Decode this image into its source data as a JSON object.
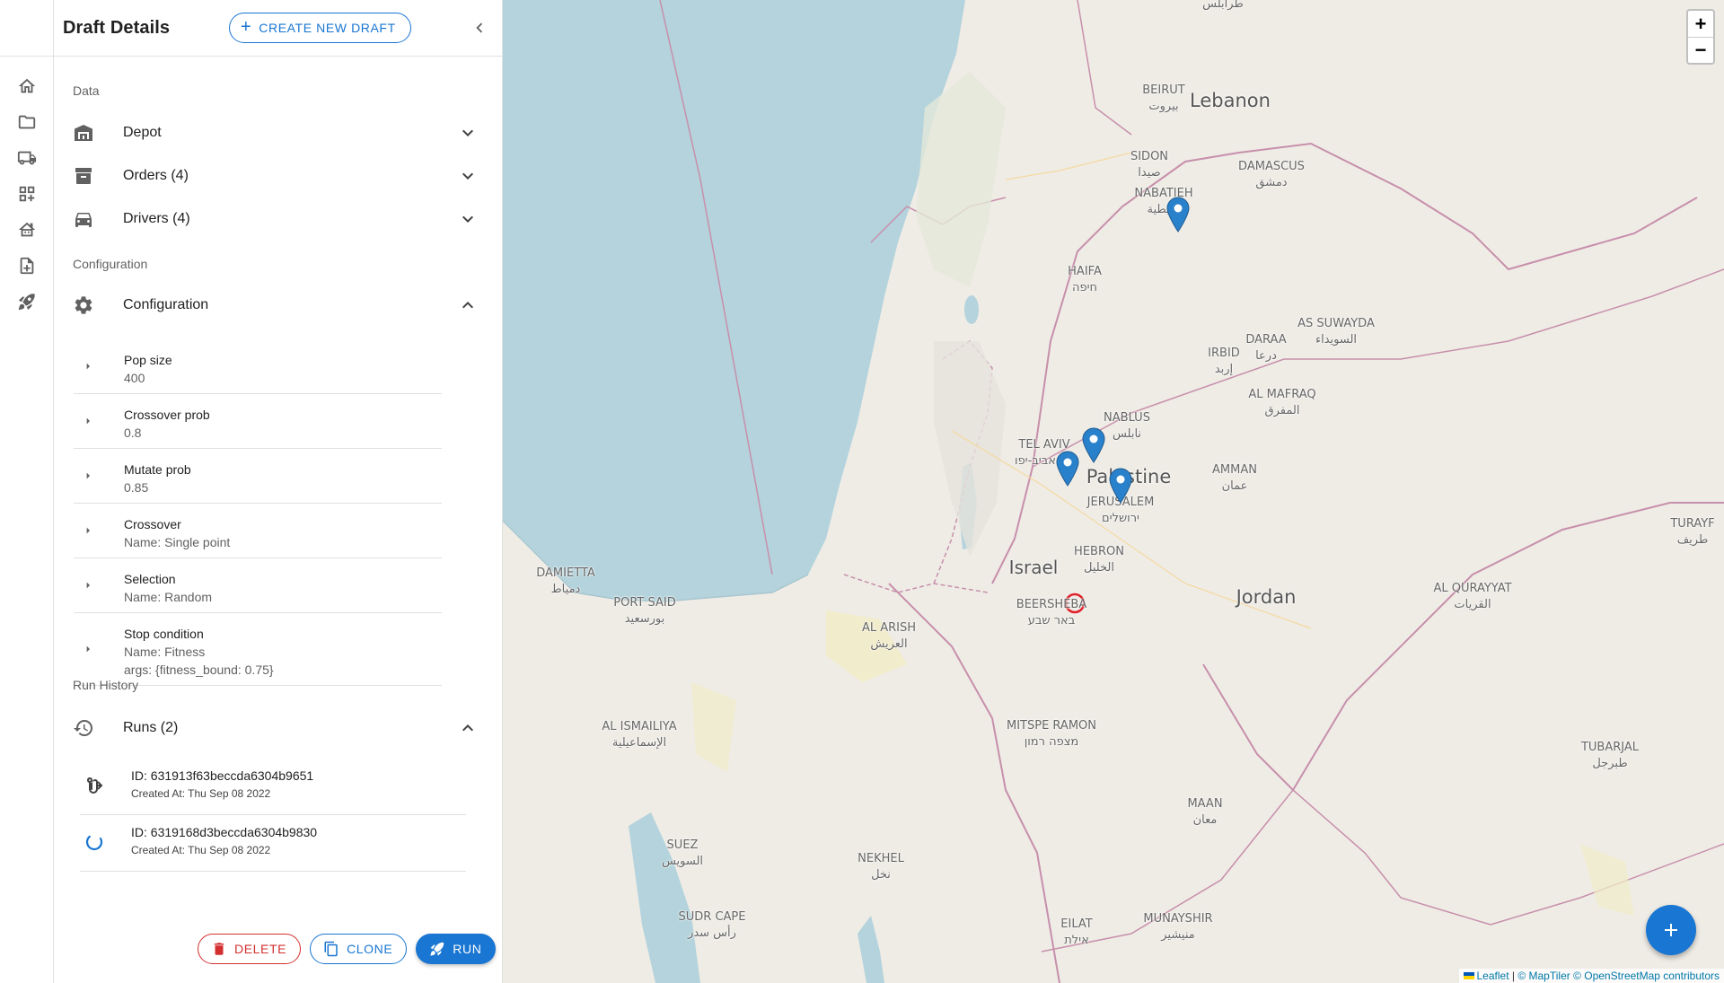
{
  "rail": {
    "items": [
      {
        "icon": "home-icon"
      },
      {
        "icon": "folder-icon"
      },
      {
        "icon": "truck-icon"
      },
      {
        "icon": "dashboard-icon"
      },
      {
        "icon": "garage-icon"
      },
      {
        "icon": "note-add-icon"
      },
      {
        "icon": "rocket-icon"
      }
    ]
  },
  "drawer": {
    "title": "Draft Details",
    "create_button": "CREATE NEW DRAFT",
    "sections": {
      "data": "Data",
      "configuration": "Configuration",
      "run_history": "Run History"
    },
    "accordions": {
      "depot": "Depot",
      "orders": "Orders (4)",
      "drivers": "Drivers (4)",
      "configuration": "Configuration",
      "runs": "Runs (2)"
    },
    "config_items": [
      {
        "name": "Pop size",
        "lines": [
          "400"
        ]
      },
      {
        "name": "Crossover prob",
        "lines": [
          "0.8"
        ]
      },
      {
        "name": "Mutate prob",
        "lines": [
          "0.85"
        ]
      },
      {
        "name": "Crossover",
        "lines": [
          "Name: Single point"
        ]
      },
      {
        "name": "Selection",
        "lines": [
          "Name: Random"
        ]
      },
      {
        "name": "Stop condition",
        "lines": [
          "Name: Fitness",
          "args: {fitness_bound: 0.75}"
        ]
      }
    ],
    "runs": [
      {
        "id": "ID: 631913f63beccda6304b9651",
        "created": "Created At: Thu Sep 08 2022",
        "status_icon": "route-icon"
      },
      {
        "id": "ID: 6319168d3beccda6304b9830",
        "created": "Created At: Thu Sep 08 2022",
        "status_icon": "spinner-icon"
      }
    ],
    "actions": {
      "delete": "DELETE",
      "clone": "CLONE",
      "run": "RUN"
    }
  },
  "map": {
    "zoom_in": "+",
    "zoom_out": "−",
    "attribution": {
      "leaflet": "Leaflet",
      "sep": " | ",
      "maptiler": "© MapTiler",
      "osm": "© OpenStreetMap contributors"
    },
    "labels": {
      "tarabulus": "طرابلس",
      "beirut": "BEIRUT\nبيروت",
      "lebanon": "Lebanon",
      "sidon": "SIDON\nصيدا",
      "nabatieh": "NABATIEH\nالنبطية",
      "damascus": "DAMASCUS\nدمشق",
      "haifa": "HAIFA\nחיפה",
      "daraa": "DARAA\nدرعا",
      "as_suwayda": "AS SUWAYDA\nالسويداء",
      "irbid": "IRBID\nإربد",
      "al_mafraq": "AL MAFRAQ\nالمفرق",
      "nablus": "NABLUS\nنابلس",
      "tel_aviv": "TEL AVIV\nתל אביב-יפו",
      "palestine": "Palestine",
      "jerusalem": "JERUSALEM\nירושלים",
      "amman": "AMMAN\nعمان",
      "turayf": "TURAYF\nطريف",
      "hebron": "HEBRON\nالخليل",
      "israel": "Israel",
      "damietta": "DAMIETTA\nدمياط",
      "port_said": "PORT SAID\nبورسعيد",
      "beersheba": "BEERSHEBA\nבאר שבע",
      "al_arish": "AL ARISH\nالعريش",
      "jordan": "Jordan",
      "al_qurayyat": "AL QURAYYAT\nالقريات",
      "al_ismailiya": "AL ISMAILIYA\nالإسماعيلية",
      "mitspe_ramon": "MITSPE RAMON\nמצפה רמון",
      "tubarjal": "TUBARJAL\nطبرجل",
      "maan": "MAAN\nمعان",
      "suez": "SUEZ\nالسويس",
      "nekhel": "NEKHEL\nنخل",
      "sudr_cape": "SUDR CAPE\nرأس سدر",
      "eilat": "EILAT\nאילת",
      "munayshir": "MUNAYSHIR\nمنيشير"
    },
    "colors": {
      "sea": "#b4d3dc",
      "land": "#efece6",
      "marker": "#2a81cb",
      "depot_circle": "#e0202a",
      "accent": "#1976d2",
      "delete": "#d32f2f"
    }
  }
}
